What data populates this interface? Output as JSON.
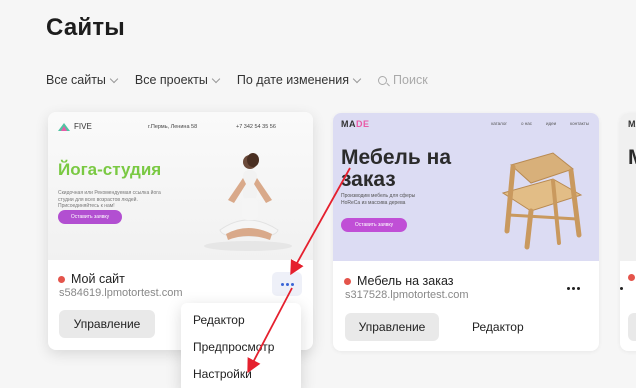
{
  "page": {
    "title": "Сайты"
  },
  "filters": {
    "all_sites": "Все сайты",
    "all_projects": "Все проекты",
    "sort": "По дате изменения",
    "search_placeholder": "Поиск"
  },
  "cards": [
    {
      "thumbnail": {
        "brand": "FIVE",
        "address": "г.Пермь, Ленина 58",
        "phone": "+7 342 54 35 56",
        "headline": "Йога-студия",
        "description": "Скидочная или Рекомендуемая ссылка йога студии для всех возрастов людей. Присоединяйтесь к нам!",
        "cta": "Оставить заявку"
      },
      "name": "Мой сайт",
      "domain": "s584619.lpmotortest.com",
      "manage_label": "Управление",
      "status_color": "#e4544b"
    },
    {
      "thumbnail": {
        "brand_prefix": "MA",
        "brand_suffix": "DE",
        "nav": [
          "каталог",
          "о нас",
          "идеи",
          "контакты"
        ],
        "headline": "Мебель на заказ",
        "description": "Производим мебель для сферы HoReCa из массива дерева",
        "cta": "Оставить заявку"
      },
      "name": "Мебель на заказ",
      "domain": "s317528.lpmotortest.com",
      "manage_label": "Управление",
      "editor_label": "Редактор",
      "status_color": "#e4544b"
    },
    {
      "thumbnail": {
        "brand": "MA",
        "headline": "М"
      },
      "status_color": "#e4544b"
    }
  ],
  "dropdown": {
    "items": [
      "Редактор",
      "Предпросмотр",
      "Настройки"
    ]
  },
  "colors": {
    "accent": "#3b66d6",
    "annotation_arrow": "#e5202e"
  }
}
